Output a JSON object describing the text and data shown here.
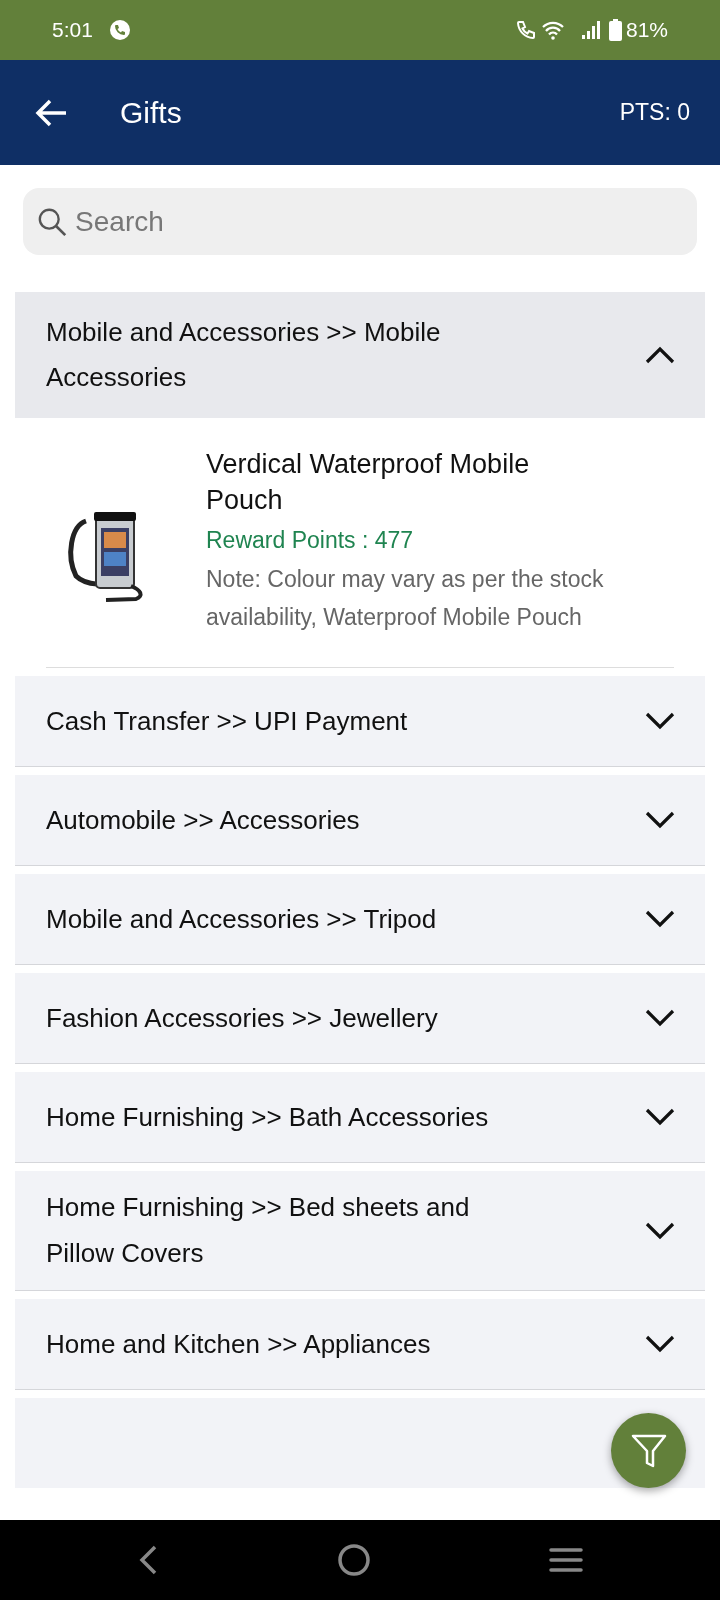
{
  "status_bar": {
    "time": "5:01",
    "battery": "81%"
  },
  "app_bar": {
    "title": "Gifts",
    "points": "PTS: 0"
  },
  "search": {
    "placeholder": "Search"
  },
  "categories": [
    {
      "label": "Mobile and Accessories >> Mobile Accessories",
      "expanded": true,
      "items": [
        {
          "title": "Verdical Waterproof Mobile Pouch",
          "reward": "Reward Points : 477",
          "note": "Note: Colour may vary as per the stock availability, Waterproof Mobile Pouch"
        }
      ]
    },
    {
      "label": "Cash Transfer >> UPI Payment",
      "expanded": false
    },
    {
      "label": "Automobile >> Accessories",
      "expanded": false
    },
    {
      "label": "Mobile and Accessories >> Tripod",
      "expanded": false
    },
    {
      "label": "Fashion Accessories >> Jewellery",
      "expanded": false
    },
    {
      "label": "Home Furnishing >> Bath Accessories",
      "expanded": false
    },
    {
      "label": "Home Furnishing >> Bed sheets and Pillow Covers",
      "expanded": false
    },
    {
      "label": "Home and Kitchen >> Appliances",
      "expanded": false
    },
    {
      "expanded": false
    }
  ]
}
